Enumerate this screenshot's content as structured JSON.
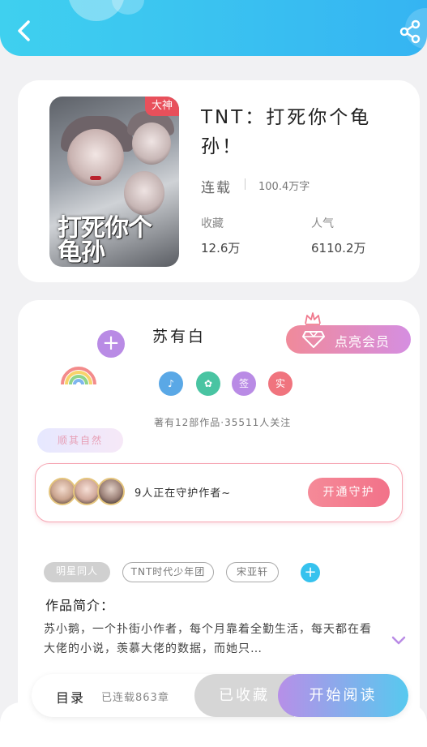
{
  "header": {
    "back_icon": "chevron-left-icon",
    "share_icon": "share-icon",
    "background": "#35b4f2"
  },
  "book": {
    "title": "TNT：打死你个龟孙！",
    "badge": "大神",
    "cover_title": "打死你个龟孙",
    "status": "连载",
    "word_count": "100.4万字",
    "stats": [
      {
        "label": "收藏",
        "value": "12.6万"
      },
      {
        "label": "人气",
        "value": "6110.2万"
      }
    ]
  },
  "author": {
    "name": "苏有白",
    "vip_button": "点亮会员",
    "nature_badge": "顺其自然",
    "medals": [
      {
        "text": "",
        "color": "#5aa8e6"
      },
      {
        "text": "",
        "color": "#49c4a2"
      },
      {
        "text": "签",
        "color": "#b98be5"
      },
      {
        "text": "实",
        "color": "#f0747e"
      }
    ],
    "works_info": "著有12部作品·35511人关注"
  },
  "guard": {
    "text": "9人正在守护作者~",
    "button": "开通守护"
  },
  "tags": [
    "明星同人",
    "TNT时代少年团",
    "宋亚轩"
  ],
  "intro": {
    "title": "作品简介：",
    "text": "苏小鹅，一个扑街小作者，每个月靠着全勤生活，每天都在看大佬的小说，羡慕大佬的数据，而她只…"
  },
  "bottom_bar": {
    "toc_label": "目录",
    "toc_count": "已连载863章",
    "collect_button": "已收藏",
    "read_button": "开始阅读"
  }
}
